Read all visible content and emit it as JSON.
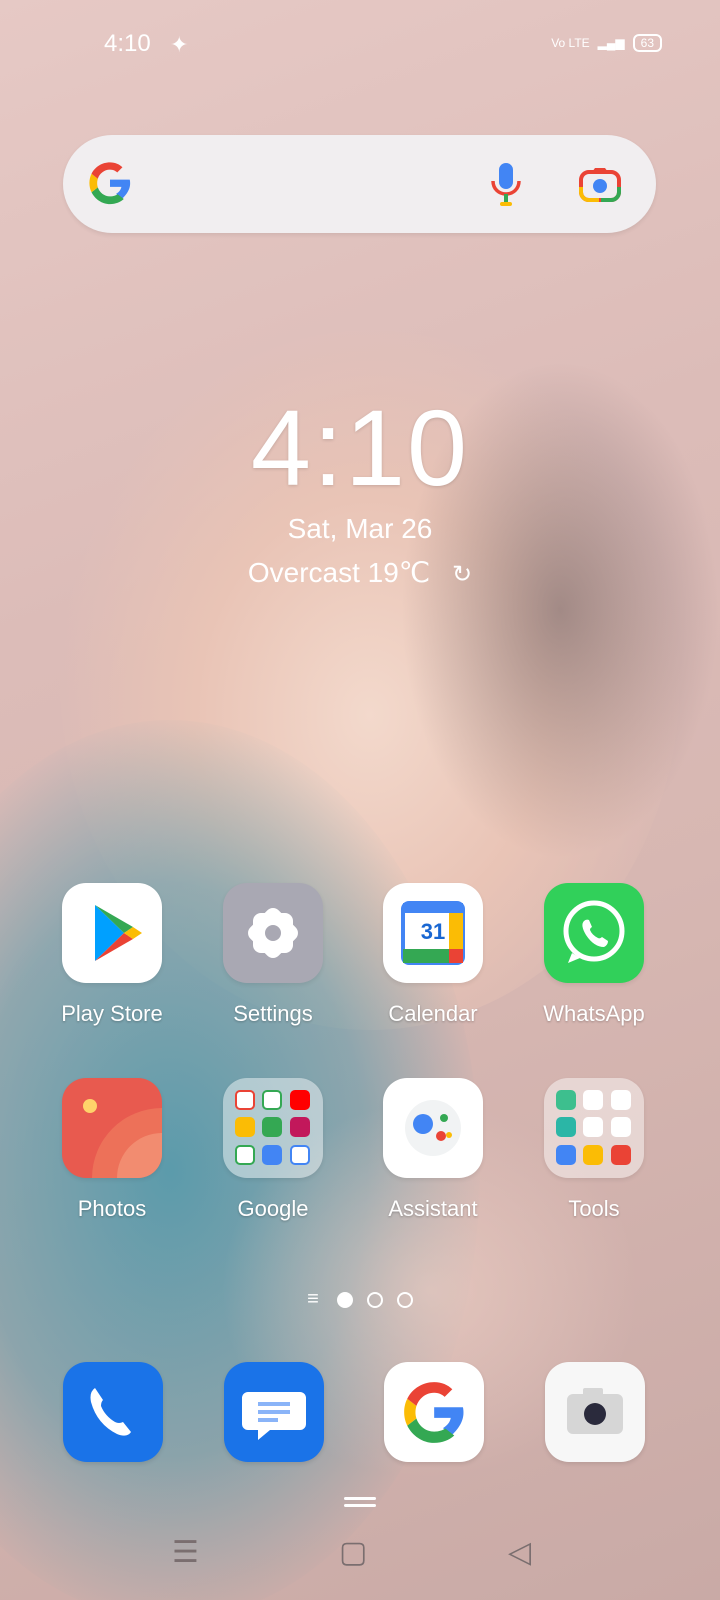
{
  "status_bar": {
    "time": "4:10",
    "network": "Vo LTE",
    "battery": "63"
  },
  "search": {
    "icons": [
      "google-g-icon",
      "mic-icon",
      "lens-icon"
    ]
  },
  "clock_widget": {
    "time": "4:10",
    "date": "Sat, Mar 26",
    "weather": "Overcast 19℃"
  },
  "apps_row1": [
    {
      "label": "Play Store",
      "icon": "play-store-icon"
    },
    {
      "label": "Settings",
      "icon": "settings-icon"
    },
    {
      "label": "Calendar",
      "icon": "calendar-icon",
      "badge": "31"
    },
    {
      "label": "WhatsApp",
      "icon": "whatsapp-icon"
    }
  ],
  "apps_row2": [
    {
      "label": "Photos",
      "icon": "photos-icon"
    },
    {
      "label": "Google",
      "icon": "google-folder-icon"
    },
    {
      "label": "Assistant",
      "icon": "assistant-icon"
    },
    {
      "label": "Tools",
      "icon": "tools-folder-icon"
    }
  ],
  "dock": [
    {
      "icon": "phone-icon"
    },
    {
      "icon": "messages-icon"
    },
    {
      "icon": "google-icon"
    },
    {
      "icon": "camera-icon"
    }
  ],
  "page_indicator": {
    "pages": 3,
    "current": 1
  },
  "colors": {
    "playstore_bg": "#ffffff",
    "settings_bg": "#a9a8b3",
    "whatsapp_bg": "#31d05a",
    "photos_bg": "#e85a4f",
    "phone_bg": "#1a73e8",
    "messages_bg": "#1a73e8"
  }
}
